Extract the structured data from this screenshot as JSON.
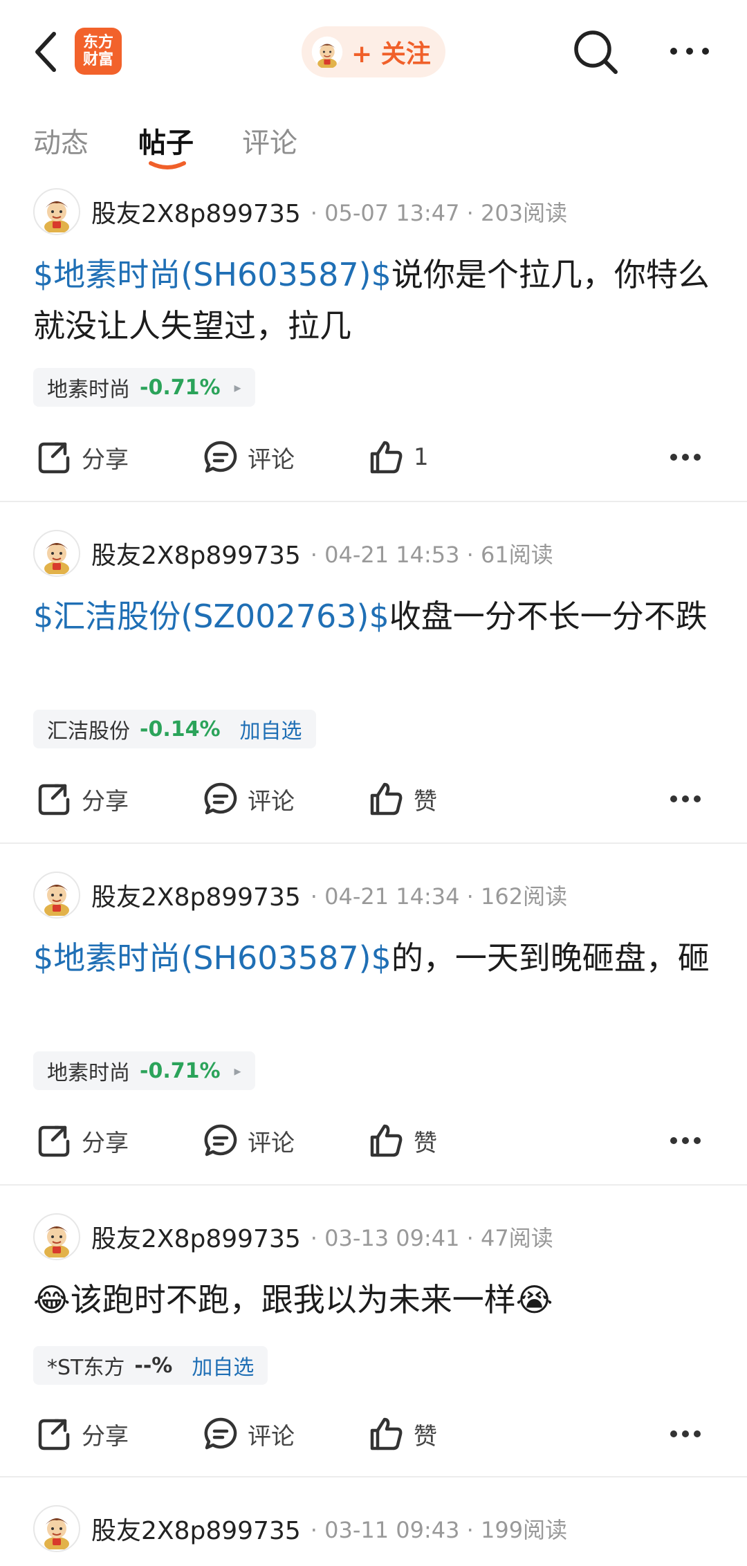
{
  "header": {
    "logo_line1": "东方",
    "logo_line2": "财富",
    "follow_label": "+ 关注",
    "icons": [
      "back-icon",
      "search-icon",
      "more-icon"
    ]
  },
  "tabs": [
    {
      "label": "动态",
      "active": false
    },
    {
      "label": "帖子",
      "active": true
    },
    {
      "label": "评论",
      "active": false
    }
  ],
  "colors": {
    "accent": "#f0602a",
    "link": "#1f6fb5",
    "down": "#2ba35a",
    "chip_bg": "#f4f5f7"
  },
  "posts": [
    {
      "username": "股友2X8p899735",
      "meta": "· 05-07 13:47 · 203阅读",
      "stock_tag": "$地素时尚(SH603587)$",
      "text": "说你是个拉几，你特么就没让人失望过，拉几",
      "chip_name": "地素时尚",
      "chip_change": "-0.71%",
      "chip_extra": "▸",
      "share": "分享",
      "comment": "评论",
      "like": "1"
    },
    {
      "username": "股友2X8p899735",
      "meta": "· 04-21 14:53 · 61阅读",
      "stock_tag": "$汇洁股份(SZ002763)$",
      "text": "收盘一分不长一分不跌",
      "chip_name": "汇洁股份",
      "chip_change": "-0.14%",
      "chip_extra": "加自选",
      "share": "分享",
      "comment": "评论",
      "like": "赞"
    },
    {
      "username": "股友2X8p899735",
      "meta": "· 04-21 14:34 · 162阅读",
      "stock_tag": "$地素时尚(SH603587)$",
      "text": "的，一天到晚砸盘，砸",
      "chip_name": "地素时尚",
      "chip_change": "-0.71%",
      "chip_extra": "▸",
      "share": "分享",
      "comment": "评论",
      "like": "赞"
    },
    {
      "username": "股友2X8p899735",
      "meta": "· 03-13 09:41 · 47阅读",
      "emoji_before": "😂",
      "text": "该跑时不跑，跟我以为未来一样",
      "emoji_after": "😭",
      "chip_name": "*ST东方",
      "chip_change": "--%",
      "chip_extra": "加自选",
      "share": "分享",
      "comment": "评论",
      "like": "赞"
    },
    {
      "username": "股友2X8p899735",
      "meta": "· 03-11 09:43 · 199阅读"
    }
  ]
}
